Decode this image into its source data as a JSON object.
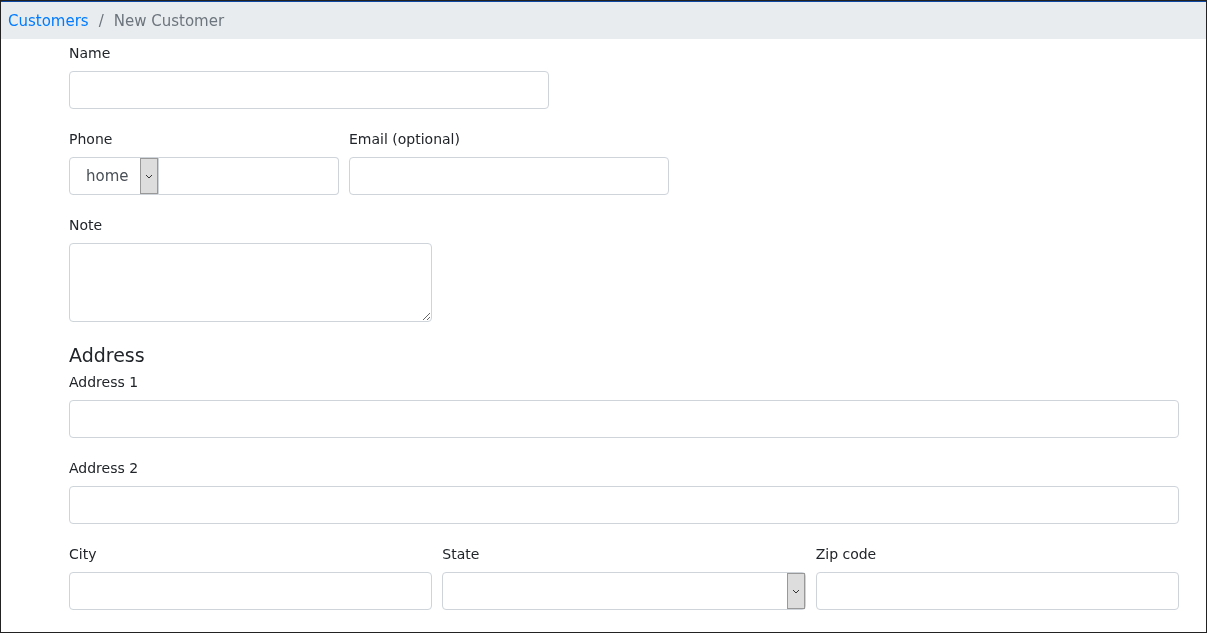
{
  "breadcrumb_separator": "/",
  "breadcrumb": [
    {
      "label": "Customers",
      "kind": "link"
    },
    {
      "label": "New Customer",
      "kind": "current"
    }
  ],
  "name": {
    "label": "Name"
  },
  "phone": {
    "label": "Phone",
    "type_value": "home"
  },
  "email": {
    "label": "Email (optional)"
  },
  "note": {
    "label": "Note"
  },
  "address": {
    "heading": "Address",
    "address1": {
      "label": "Address 1"
    },
    "address2": {
      "label": "Address 2"
    },
    "city": {
      "label": "City"
    },
    "state": {
      "label": "State"
    },
    "zip": {
      "label": "Zip code"
    }
  }
}
